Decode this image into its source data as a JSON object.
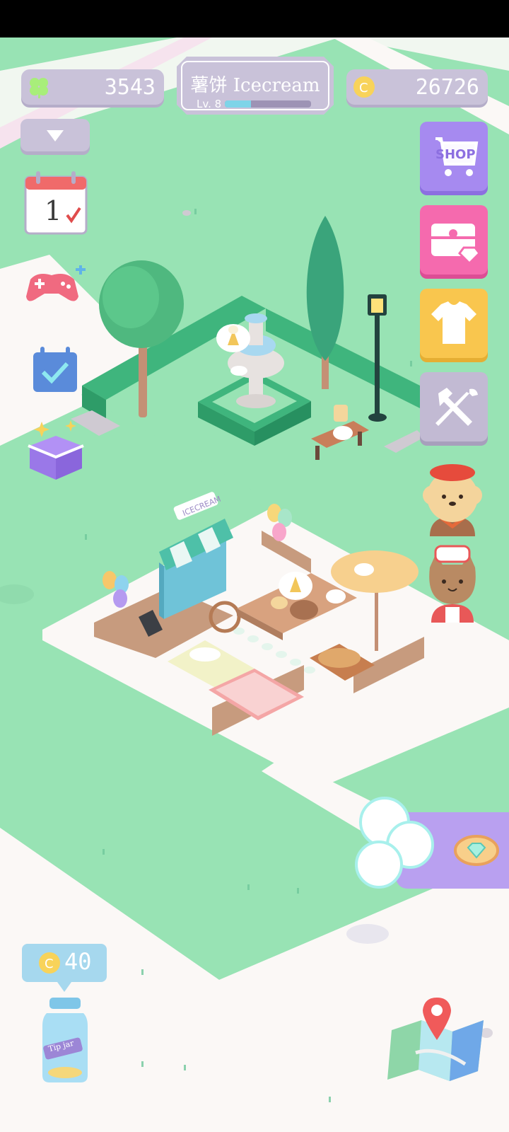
{
  "hud": {
    "clover_count": "3543",
    "coin_count": "26726",
    "title": "薯饼 Icecream",
    "level": "Lv. 8",
    "level_progress": 0.3
  },
  "menu": {
    "calendar_day": "1",
    "shop_label": "SHOP"
  },
  "scene": {
    "icecream_sign": "ICECREAM"
  },
  "tip_jar": {
    "reward": "40",
    "jar_label": "Tip jar"
  },
  "colors": {
    "grass": "#98E3B4",
    "path": "#FBF8F6",
    "hud_plate": "#C9C2D9",
    "shop_purple": "#A68AF0",
    "chest_pink": "#F56AAE",
    "outfit_yellow": "#F9C64E",
    "tools_grey": "#C2BAD3",
    "xp_fill": "#7ED4E8"
  }
}
